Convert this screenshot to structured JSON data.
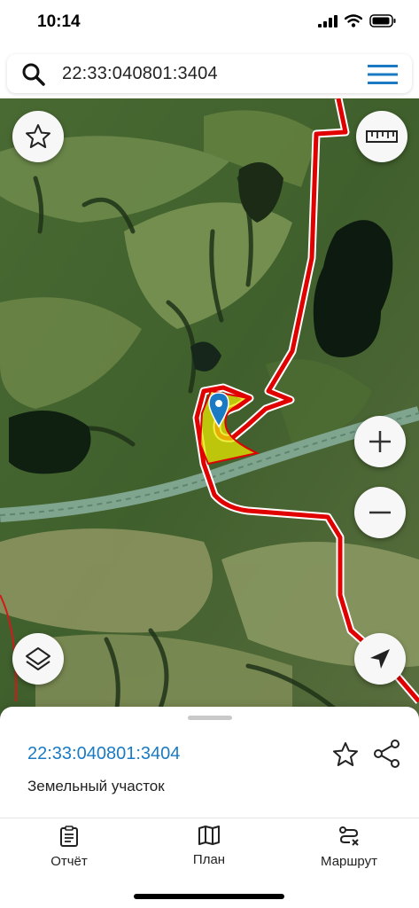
{
  "status": {
    "time": "10:14"
  },
  "search": {
    "query": "22:33:040801:3404"
  },
  "map": {
    "boundary_color": "#e00000",
    "parcel_fill": "#e8e800",
    "marker_color": "#1a7bc4"
  },
  "sheet": {
    "parcel_id": "22:33:040801:3404",
    "parcel_type": "Земельный участок"
  },
  "tabs": [
    {
      "label": "Отчёт",
      "icon": "report-icon"
    },
    {
      "label": "План",
      "icon": "map-plan-icon"
    },
    {
      "label": "Маршрут",
      "icon": "route-icon"
    }
  ]
}
